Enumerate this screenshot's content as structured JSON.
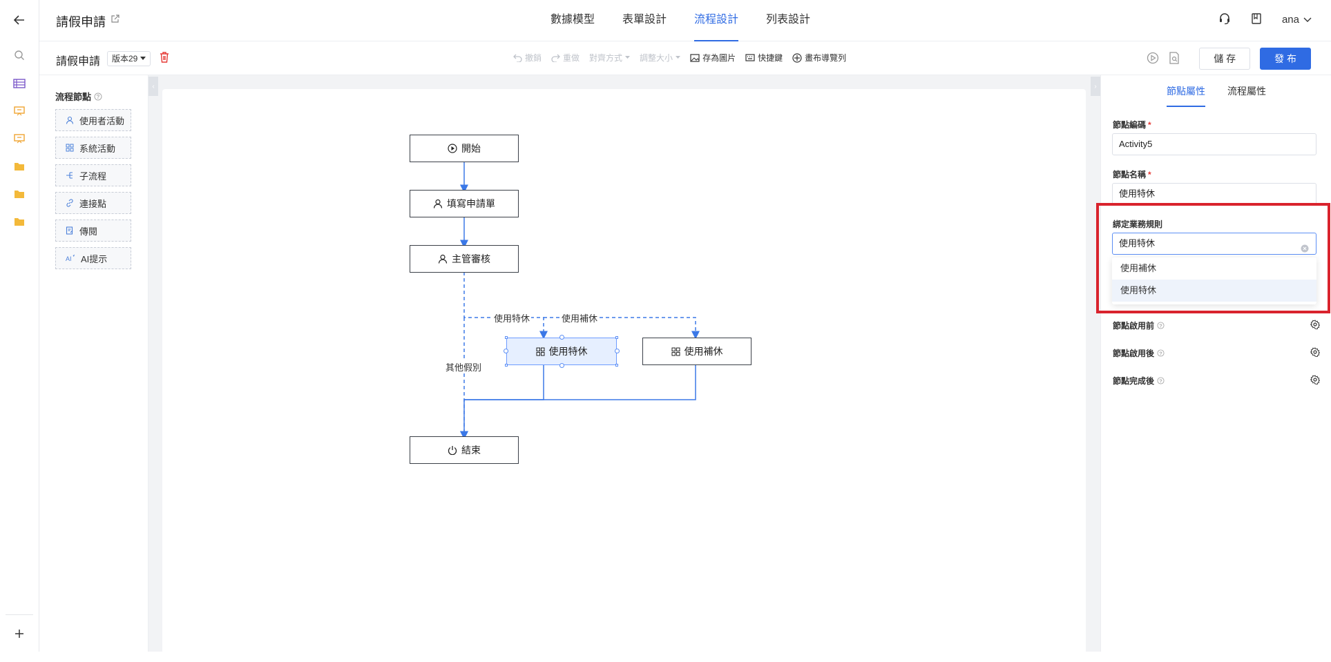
{
  "header": {
    "app_title": "請假申請",
    "tabs": [
      {
        "label": "數據模型",
        "active": false
      },
      {
        "label": "表單設計",
        "active": false
      },
      {
        "label": "流程設計",
        "active": true
      },
      {
        "label": "列表設計",
        "active": false
      }
    ],
    "user_name": "ana"
  },
  "toolbar": {
    "flow_name": "請假申請",
    "version": "版本29",
    "tools": {
      "undo": "撤銷",
      "redo": "重做",
      "align": "對齊方式",
      "resize": "調整大小",
      "save_image": "存為圖片",
      "shortcuts": "快捷鍵",
      "canvas_nav": "畫布導覽列"
    },
    "save_label": "儲 存",
    "publish_label": "發 布"
  },
  "palette": {
    "title": "流程節點",
    "items": [
      {
        "label": "使用者活動",
        "icon": "user-icon"
      },
      {
        "label": "系統活動",
        "icon": "grid-icon"
      },
      {
        "label": "子流程",
        "icon": "subflow-icon"
      },
      {
        "label": "連接點",
        "icon": "link-icon"
      },
      {
        "label": "傳閱",
        "icon": "circulate-icon"
      },
      {
        "label": "AI提示",
        "icon": "ai-icon"
      }
    ]
  },
  "flow": {
    "nodes": {
      "start": "開始",
      "fill": "填寫申請單",
      "review": "主管審核",
      "special": "使用特休",
      "comp": "使用補休",
      "end": "結束"
    },
    "edge_labels": {
      "special": "使用特休",
      "comp": "使用補休",
      "other": "其他假別"
    }
  },
  "properties": {
    "tabs": [
      {
        "label": "節點屬性",
        "active": true
      },
      {
        "label": "流程屬性",
        "active": false
      }
    ],
    "node_code_label": "節點編碼",
    "node_code_value": "Activity5",
    "node_name_label": "節點名稱",
    "node_name_value": "使用特休",
    "rule_label": "綁定業務規則",
    "rule_value": "使用特休",
    "rule_options": [
      "使用補休",
      "使用特休"
    ],
    "hooks": [
      "節點啟用前",
      "節點啟用後",
      "節點完成後"
    ]
  },
  "colors": {
    "accent": "#2f6be3",
    "highlight": "#d9232d",
    "required": "#e53935"
  }
}
